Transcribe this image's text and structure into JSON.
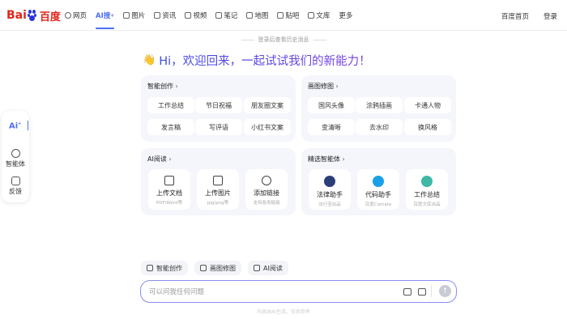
{
  "brand": {
    "part1": "Bai",
    "part2": "百度"
  },
  "nav": [
    {
      "label": "网页",
      "icon": "search-icon"
    },
    {
      "label": "AI搜",
      "icon": "",
      "active": true
    },
    {
      "label": "图片",
      "icon": "image-icon"
    },
    {
      "label": "资讯",
      "icon": "news-icon"
    },
    {
      "label": "视频",
      "icon": "video-icon"
    },
    {
      "label": "笔记",
      "icon": "note-icon"
    },
    {
      "label": "地图",
      "icon": "map-icon"
    },
    {
      "label": "贴吧",
      "icon": "tieba-icon"
    },
    {
      "label": "文库",
      "icon": "doc-icon"
    },
    {
      "label": "更多",
      "icon": ""
    }
  ],
  "top_right": {
    "home": "百度首页",
    "login": "登录"
  },
  "rail": {
    "ai_label": "Ai",
    "agent": "智能体",
    "feedback": "反馈"
  },
  "history_note": "登录后查看历史消息",
  "greeting": {
    "emoji": "👋",
    "text": "Hi，欢迎回来，一起试试我们的新能力！"
  },
  "panels": {
    "writing": {
      "title": "智能创作",
      "items": [
        "工作总结",
        "节日祝福",
        "朋友圈文案",
        "发言稿",
        "写评语",
        "小红书文案"
      ]
    },
    "image_edit": {
      "title": "画图修图",
      "items": [
        "国风头像",
        "涂鸦插画",
        "卡通人物",
        "变清晰",
        "去水印",
        "换风格"
      ]
    },
    "reading": {
      "title": "AI阅读",
      "cards": [
        {
          "title": "上传文档",
          "sub": "PDF/Word等",
          "icon": "folder-icon"
        },
        {
          "title": "上传图片",
          "sub": "jpg/png等",
          "icon": "image-icon"
        },
        {
          "title": "添加链接",
          "sub": "支持各类链接",
          "icon": "globe-icon"
        }
      ]
    },
    "agents": {
      "title": "精选智能体",
      "cards": [
        {
          "title": "法律助手",
          "sub": "法行宝出品",
          "icon": "lawyer-avatar-icon",
          "color": "#2c3e78"
        },
        {
          "title": "代码助手",
          "sub": "百度Comate",
          "icon": "code-assistant-icon",
          "color": "#1aa0e8"
        },
        {
          "title": "工作总结",
          "sub": "百度文库出品",
          "icon": "worker-avatar-icon",
          "color": "#3fb8a6"
        }
      ]
    }
  },
  "bottom_tabs": [
    {
      "label": "智能创作",
      "icon": "pen-icon"
    },
    {
      "label": "画图修图",
      "icon": "picture-icon"
    },
    {
      "label": "AI阅读",
      "icon": "book-icon"
    }
  ],
  "input": {
    "placeholder": "可以问我任何问题"
  },
  "footer_note": "内容由AI生成，仅供参考",
  "colors": {
    "accent": "#4e6ef2",
    "brand_red": "#e1251b",
    "brand_blue": "#2932e1"
  }
}
